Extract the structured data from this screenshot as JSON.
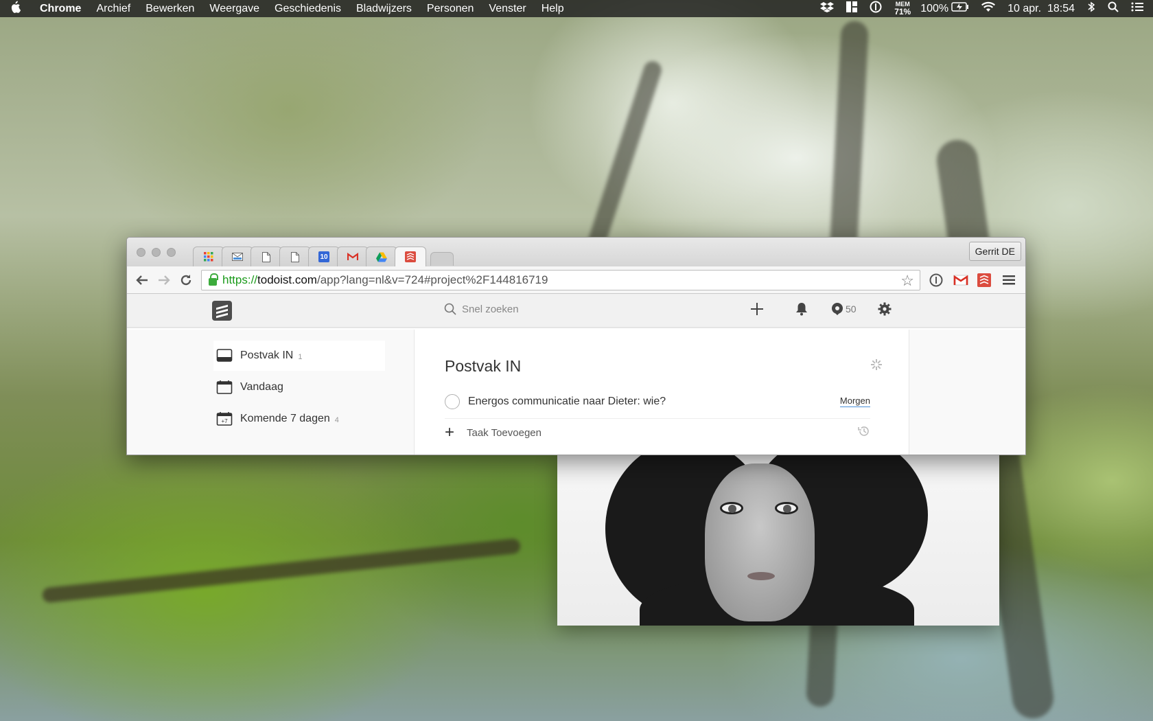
{
  "menubar": {
    "app": "Chrome",
    "items": [
      "Archief",
      "Bewerken",
      "Weergave",
      "Geschiedenis",
      "Bladwijzers",
      "Personen",
      "Venster",
      "Help"
    ],
    "mem_label": "MEM",
    "mem_value": "71%",
    "battery": "100%",
    "clock": "10 apr.  18:54"
  },
  "browser": {
    "profile_name": "Gerrit DE",
    "tab_icons": [
      "apps-icon",
      "mail-icon",
      "document-icon",
      "document-icon",
      "calendar-icon",
      "gmail-icon",
      "drive-icon",
      "todoist-icon"
    ],
    "calendar_day": "10",
    "gmail_letter": "M",
    "url_scheme": "https://",
    "url_host": "todoist.com",
    "url_path": "/app?lang=nl&v=724#project%2F144816719"
  },
  "app": {
    "search_placeholder": "Snel zoeken",
    "karma": "50",
    "sidebar": [
      {
        "label": "Postvak IN",
        "count": "1"
      },
      {
        "label": "Vandaag",
        "count": ""
      },
      {
        "label": "Komende 7 dagen",
        "count": "4"
      }
    ],
    "upcoming_icon_text": "+7",
    "project_title": "Postvak IN",
    "tasks": [
      {
        "title": "Energos communicatie naar Dieter: wie?",
        "due": "Morgen"
      }
    ],
    "add_task_label": "Taak Toevoegen"
  },
  "colors": {
    "todoist_red": "#db4c3f",
    "secure_green": "#1a9a1a",
    "due_underline": "#4a90d9"
  }
}
